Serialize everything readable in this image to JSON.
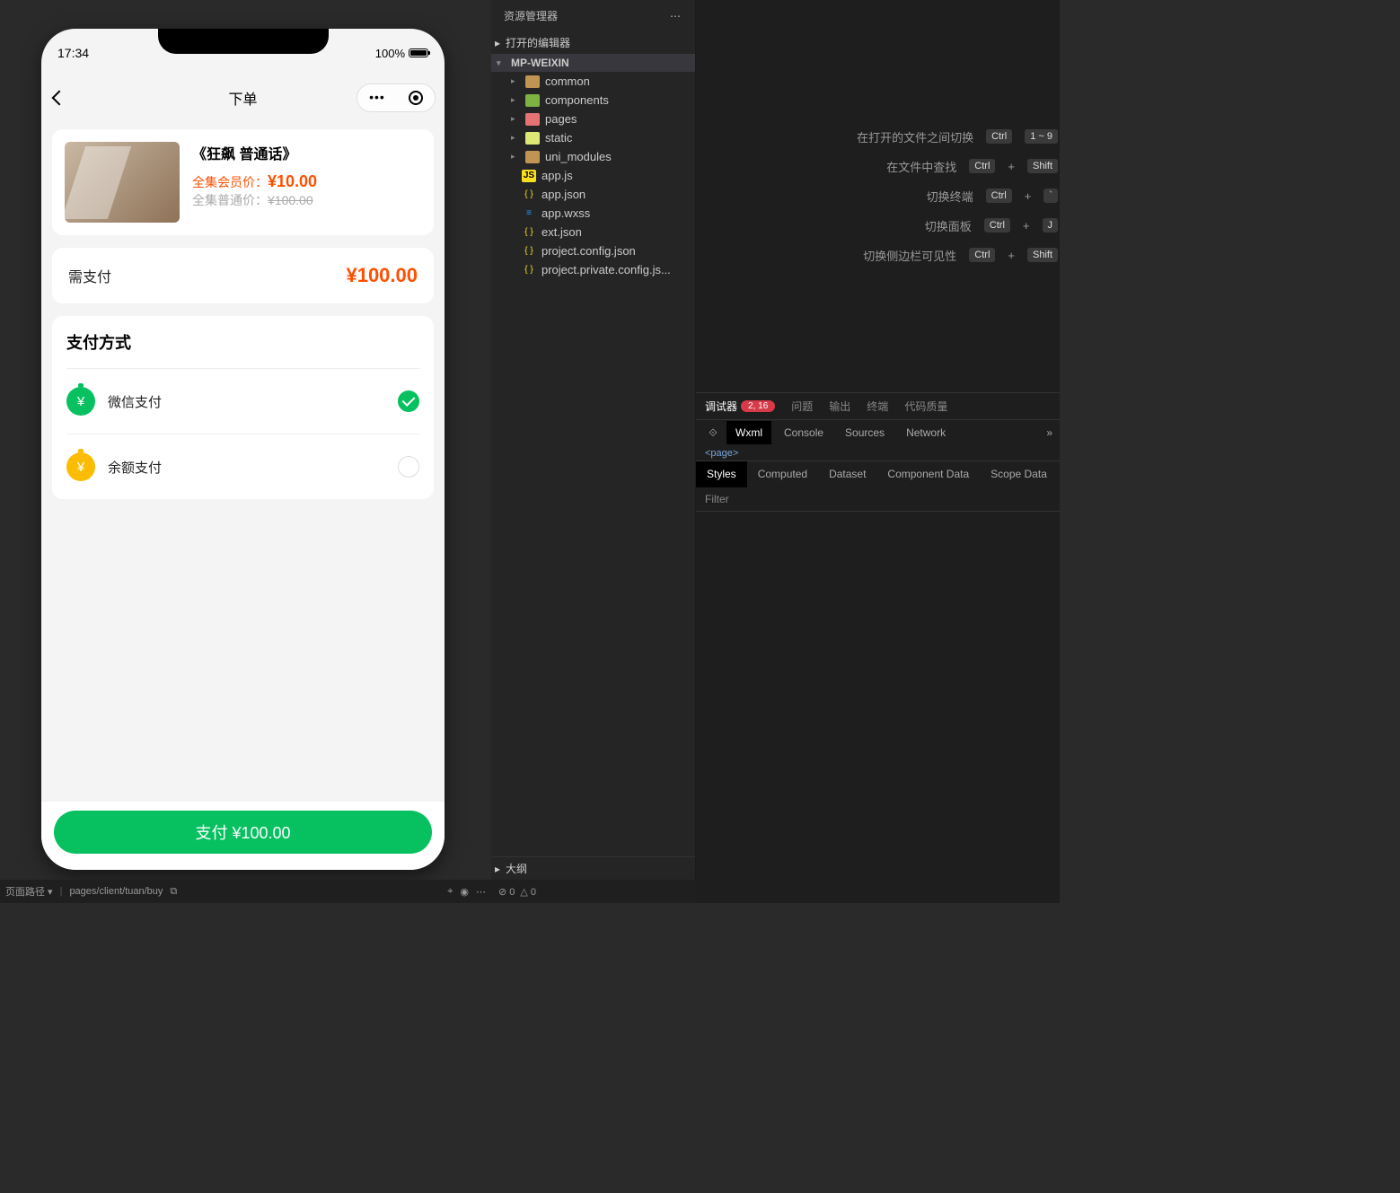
{
  "simulator": {
    "time": "17:34",
    "battery_pct": "100%",
    "nav_title": "下单",
    "product": {
      "title": "《狂飙 普通话》",
      "member_label": "全集会员价：",
      "member_price": "¥10.00",
      "regular_label": "全集普通价：",
      "regular_price": "¥100.00"
    },
    "pay_needed_label": "需支付",
    "pay_needed_amount": "¥100.00",
    "method_title": "支付方式",
    "methods": [
      {
        "name": "微信支付",
        "selected": true
      },
      {
        "name": "余额支付",
        "selected": false
      }
    ],
    "pay_button": "支付 ¥100.00"
  },
  "explorer": {
    "title": "资源管理器",
    "sections": {
      "open_editors": "打开的编辑器",
      "project": "MP-WEIXIN",
      "outline": "大纲"
    },
    "folders": [
      "common",
      "components",
      "pages",
      "static",
      "uni_modules"
    ],
    "files": [
      "app.js",
      "app.json",
      "app.wxss",
      "ext.json",
      "project.config.json",
      "project.private.config.js..."
    ]
  },
  "hints": [
    {
      "label": "在打开的文件之间切换",
      "keys": [
        "Ctrl",
        "1 ~ 9"
      ]
    },
    {
      "label": "在文件中查找",
      "keys": [
        "Ctrl",
        "+",
        "Shift"
      ]
    },
    {
      "label": "切换终端",
      "keys": [
        "Ctrl",
        "+",
        "`"
      ]
    },
    {
      "label": "切换面板",
      "keys": [
        "Ctrl",
        "+",
        "J"
      ]
    },
    {
      "label": "切换侧边栏可见性",
      "keys": [
        "Ctrl",
        "+",
        "Shift"
      ]
    }
  ],
  "panel_tabs": {
    "debugger": "调试器",
    "badge": "2, 16",
    "problems": "问题",
    "output": "输出",
    "terminal": "终端",
    "quality": "代码质量"
  },
  "dev_tabs": [
    "Wxml",
    "Console",
    "Sources",
    "Network"
  ],
  "page_tag": "<page>",
  "style_tabs": [
    "Styles",
    "Computed",
    "Dataset",
    "Component Data",
    "Scope Data"
  ],
  "filter_placeholder": "Filter",
  "status_bar": {
    "page_path_label": "页面路径",
    "page_path": "pages/client/tuan/buy",
    "errors": "0",
    "warnings": "0"
  }
}
